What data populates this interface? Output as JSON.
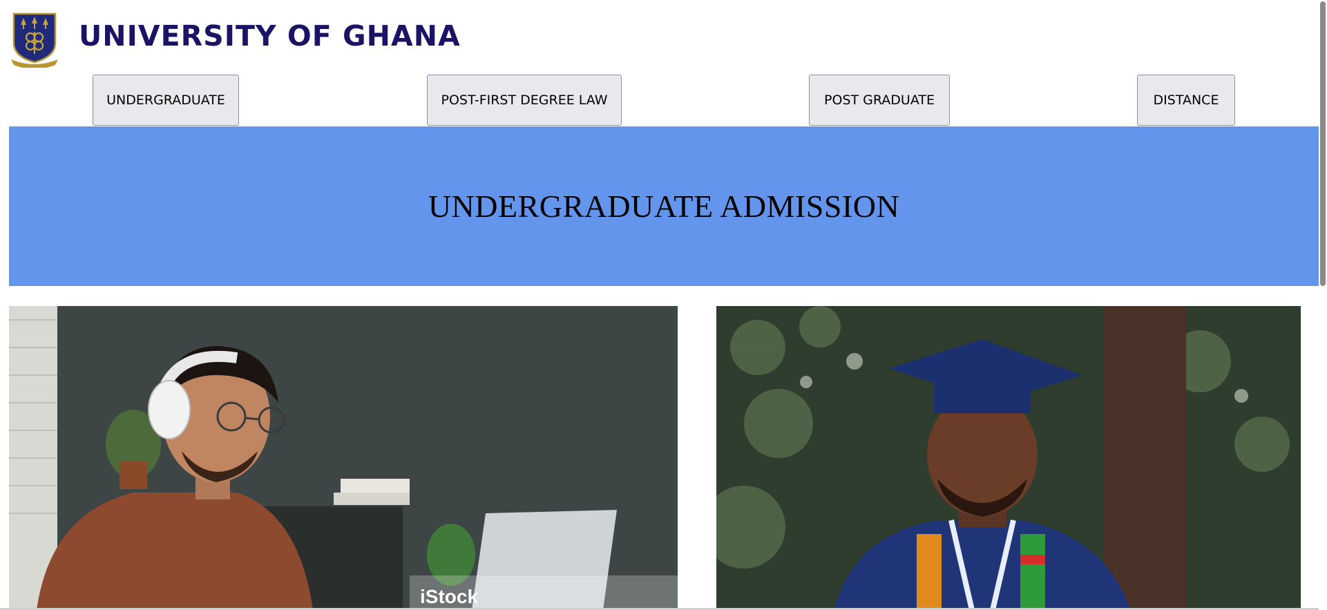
{
  "header": {
    "brand_name": "UNIVERSITY OF GHANA",
    "logo_icon": "university-crest-icon"
  },
  "nav": {
    "buttons": [
      {
        "label": "UNDERGRADUATE"
      },
      {
        "label": "POST-FIRST DEGREE LAW"
      },
      {
        "label": "POST GRADUATE"
      },
      {
        "label": "DISTANCE"
      }
    ]
  },
  "banner": {
    "title": "UNDERGRADUATE ADMISSION",
    "background_color": "#6495ed"
  },
  "photos": {
    "left": {
      "watermark": "iStock"
    }
  },
  "colors": {
    "brand_navy": "#1b1464",
    "crest_gold": "#b8962e",
    "button_bg": "#e9e9ed"
  }
}
